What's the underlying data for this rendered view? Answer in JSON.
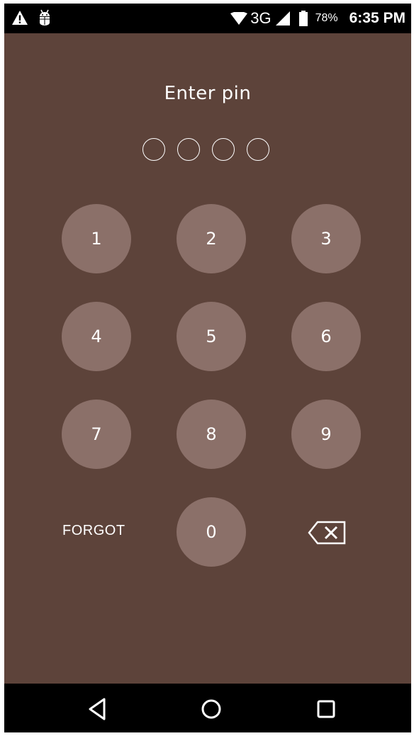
{
  "status_bar": {
    "left_icons": [
      "warning-icon",
      "android-debug-icon"
    ],
    "network": "3G",
    "battery_percent": "78%",
    "time": "6:35 PM"
  },
  "title": "Enter pin",
  "pin": {
    "length": 4,
    "entered": 0
  },
  "keypad": {
    "keys": [
      "1",
      "2",
      "3",
      "4",
      "5",
      "6",
      "7",
      "8",
      "9",
      "0"
    ],
    "forgot_label": "FORGOT",
    "backspace_icon": "backspace-icon"
  },
  "nav_bar": {
    "buttons": [
      "back-icon",
      "home-icon",
      "recents-icon"
    ]
  },
  "colors": {
    "background": "#5d433a",
    "key_fill": "#8b7069",
    "text": "#ffffff",
    "bars": "#000000"
  }
}
